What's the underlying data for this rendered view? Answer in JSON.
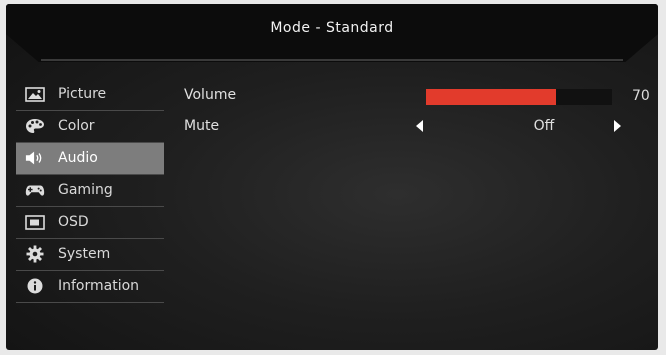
{
  "header": {
    "title": "Mode - Standard"
  },
  "sidebar": {
    "items": [
      {
        "label": "Picture",
        "icon": "picture-icon",
        "active": false
      },
      {
        "label": "Color",
        "icon": "palette-icon",
        "active": false
      },
      {
        "label": "Audio",
        "icon": "speaker-icon",
        "active": true
      },
      {
        "label": "Gaming",
        "icon": "gamepad-icon",
        "active": false
      },
      {
        "label": "OSD",
        "icon": "osd-icon",
        "active": false
      },
      {
        "label": "System",
        "icon": "gear-icon",
        "active": false
      },
      {
        "label": "Information",
        "icon": "info-icon",
        "active": false
      }
    ]
  },
  "audio": {
    "volume": {
      "label": "Volume",
      "value": "70",
      "level_percent": 70,
      "bar_color": "#e23b2c"
    },
    "mute": {
      "label": "Mute",
      "value": "Off"
    }
  },
  "colors": {
    "accent": "#e23b2c",
    "active_item_bg": "#7d7d7d"
  }
}
